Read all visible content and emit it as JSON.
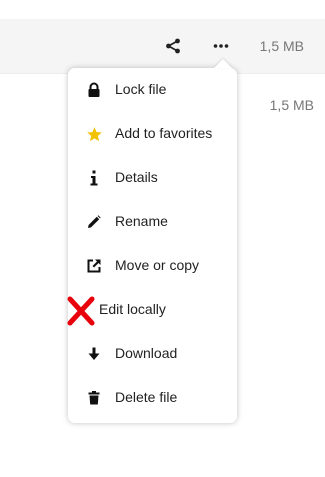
{
  "file_row": {
    "size": "1,5 MB",
    "share_icon": "share-icon",
    "more_icon": "more-horizontal-icon"
  },
  "second_row": {
    "size": "1,5 MB"
  },
  "menu": {
    "items": [
      {
        "label": "Lock file",
        "icon": "lock-icon"
      },
      {
        "label": "Add to favorites",
        "icon": "star-icon"
      },
      {
        "label": "Details",
        "icon": "info-icon"
      },
      {
        "label": "Rename",
        "icon": "pencil-icon"
      },
      {
        "label": "Move or copy",
        "icon": "external-link-icon"
      },
      {
        "label": "Edit locally",
        "icon": "red-x-icon"
      },
      {
        "label": "Download",
        "icon": "download-arrow-icon"
      },
      {
        "label": "Delete file",
        "icon": "trash-icon"
      }
    ]
  },
  "colors": {
    "star": "#f2c200",
    "red_x": "#e8000b",
    "text": "#222222",
    "muted_text": "#767676",
    "row_bg": "#f5f5f5"
  }
}
